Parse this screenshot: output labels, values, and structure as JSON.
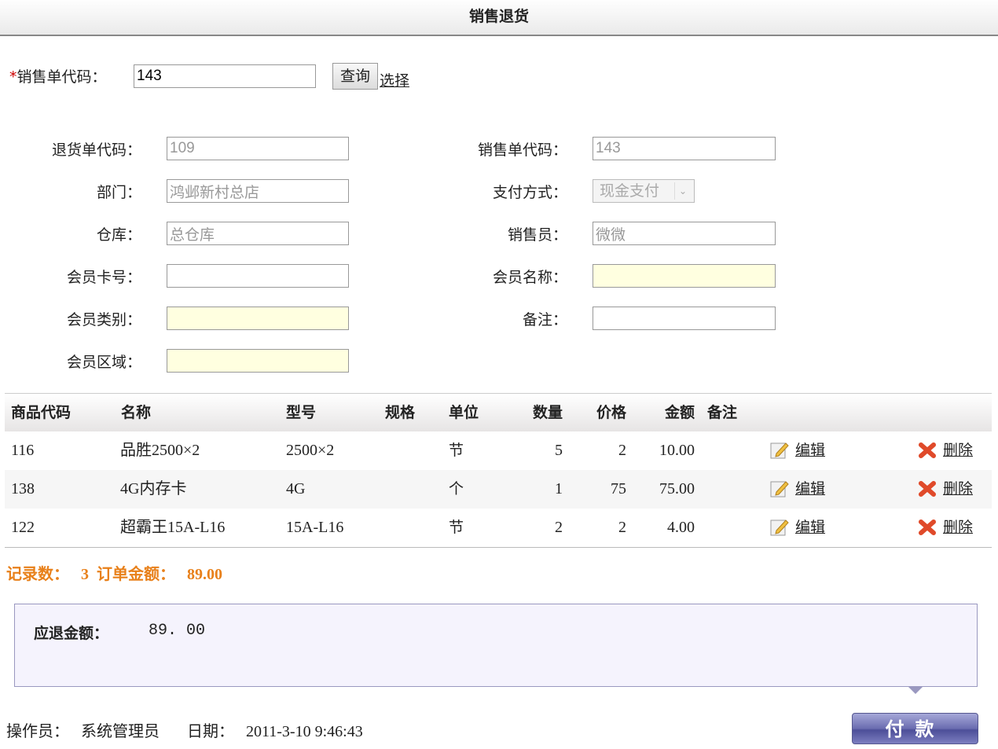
{
  "title": "销售退货",
  "query": {
    "label": "销售单代码：",
    "value": "143",
    "query_btn": "查询",
    "select_link": "选择"
  },
  "form": {
    "return_code": {
      "label": "退货单代码：",
      "value": "109"
    },
    "sales_code": {
      "label": "销售单代码：",
      "value": "143"
    },
    "dept": {
      "label": "部门：",
      "value": "鸿邺新村总店"
    },
    "payment": {
      "label": "支付方式：",
      "value": "现金支付"
    },
    "warehouse": {
      "label": "仓库：",
      "value": "总仓库"
    },
    "salesman": {
      "label": "销售员：",
      "value": "微微"
    },
    "card": {
      "label": "会员卡号：",
      "value": ""
    },
    "member_name": {
      "label": "会员名称：",
      "value": ""
    },
    "member_type": {
      "label": "会员类别：",
      "value": ""
    },
    "remark": {
      "label": "备注：",
      "value": ""
    },
    "member_area": {
      "label": "会员区域：",
      "value": ""
    }
  },
  "table": {
    "headers": [
      "商品代码",
      "名称",
      "型号",
      "规格",
      "单位",
      "数量",
      "价格",
      "金额",
      "备注"
    ],
    "rows": [
      {
        "code": "116",
        "name": "品胜2500×2",
        "model": "2500×2",
        "spec": "",
        "unit": "节",
        "qty": "5",
        "price": "2",
        "amount": "10.00",
        "remark": "",
        "edit": "编辑",
        "del": "删除"
      },
      {
        "code": "138",
        "name": "4G内存卡",
        "model": "4G",
        "spec": "",
        "unit": "个",
        "qty": "1",
        "price": "75",
        "amount": "75.00",
        "remark": "",
        "edit": "编辑",
        "del": "删除"
      },
      {
        "code": "122",
        "name": "超霸王15A-L16",
        "model": "15A-L16",
        "spec": "",
        "unit": "节",
        "qty": "2",
        "price": "2",
        "amount": "4.00",
        "remark": "",
        "edit": "编辑",
        "del": "删除"
      }
    ]
  },
  "summary": {
    "count_label": "记录数：",
    "count": "3",
    "total_label": "订单金额：",
    "total": "89.00"
  },
  "refund": {
    "label": "应退金额：",
    "value": "89. 00"
  },
  "footer": {
    "operator_label": "操作员：",
    "operator": "系统管理员",
    "date_label": "日期：",
    "date": "2011-3-10 9:46:43",
    "pay_btn": "付款"
  }
}
